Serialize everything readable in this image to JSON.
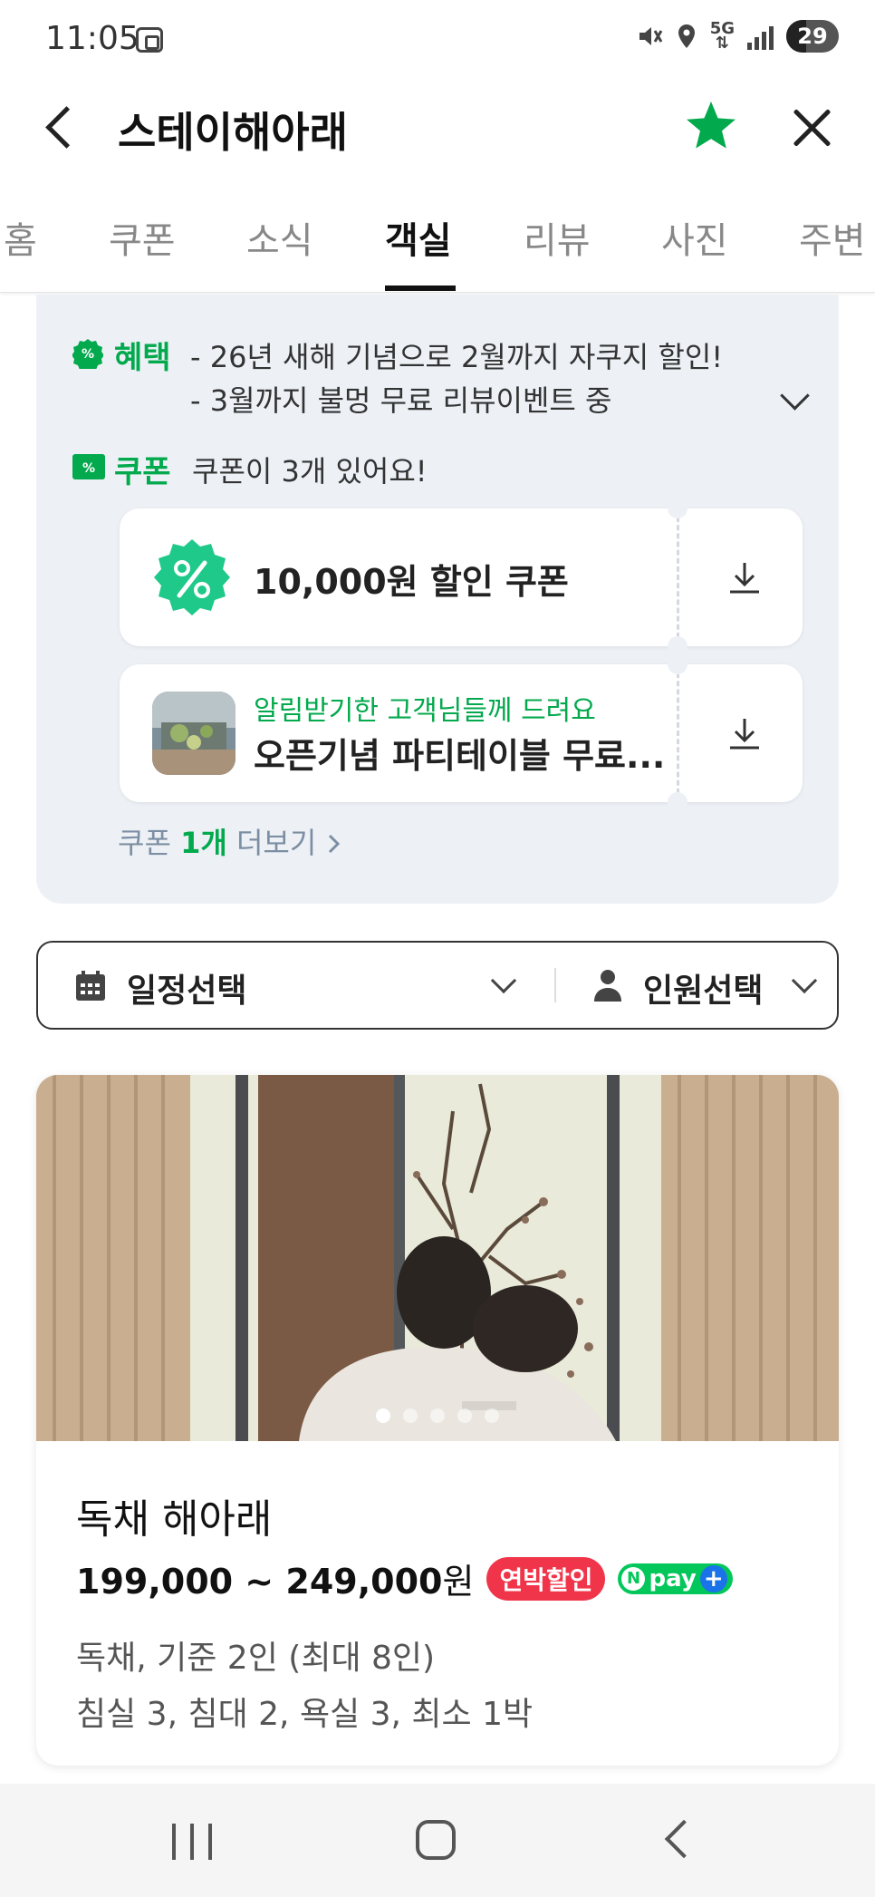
{
  "status_bar": {
    "time": "11:05",
    "network": "5G",
    "battery": "29"
  },
  "header": {
    "title": "스테이해아래",
    "favorite_icon": "star-icon",
    "favorite_color": "#03a94d"
  },
  "tabs": {
    "items": [
      {
        "label": "홈"
      },
      {
        "label": "쿠폰"
      },
      {
        "label": "소식"
      },
      {
        "label": "객실"
      },
      {
        "label": "리뷰"
      },
      {
        "label": "사진"
      },
      {
        "label": "주변"
      }
    ],
    "active": "객실"
  },
  "benefits": {
    "label": "혜택",
    "lines": [
      "- 26년 새해 기념으로 2월까지 자쿠지 할인!",
      "- 3월까지 불멍 무료 리뷰이벤트 중"
    ],
    "coupon_label": "쿠폰",
    "coupon_summary": "쿠폰이 3개 있어요!",
    "coupons": [
      {
        "title": "10,000원 할인 쿠폰",
        "icon": "percent-badge-icon"
      },
      {
        "subtitle": "알림받기한 고객님들께 드려요",
        "title": "오픈기념 파티테이블 무료..."
      }
    ],
    "more_prefix": "쿠폰 ",
    "more_count": "1개",
    "more_suffix": " 더보기"
  },
  "selector": {
    "date_label": "일정선택",
    "people_label": "인원선택"
  },
  "room": {
    "photo_count": 5,
    "photo_active": 1,
    "name": "독채 해아래",
    "price": "199,000 ~ 249,000",
    "price_unit": "원",
    "discount_tag": "연박할인",
    "npay_tag": "pay",
    "detail_1": "독채, 기준 2인 (최대 8인)",
    "detail_2": "침실 3, 침대 2, 욕실 3, 최소 1박"
  },
  "colors": {
    "accent_green": "#03a94d",
    "panel_bg": "#edf1f6",
    "discount_red": "#f0354a"
  }
}
